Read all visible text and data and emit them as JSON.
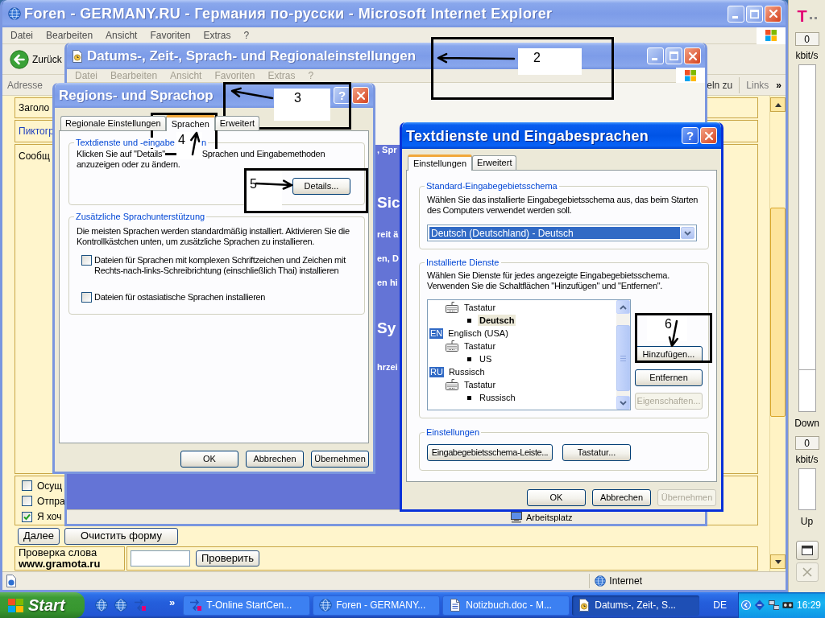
{
  "browser_window": {
    "title": "Foren - GERMANY.RU - Германия по-русски - Microsoft Internet Explorer",
    "active": false,
    "menu": {
      "disabled": false,
      "items": [
        "Datei",
        "Bearbeiten",
        "Ansicht",
        "Favoriten",
        "Extras",
        "?"
      ]
    },
    "back_button": "Zurück",
    "address_label": "Adresse",
    "go_button": "eln zu",
    "links_label": "Links",
    "links_more": "»",
    "page": {
      "form_rows": [
        {
          "kind": "label",
          "text": "Заголо"
        },
        {
          "kind": "link",
          "text": "Пиктогр"
        },
        {
          "kind": "label",
          "text": "Сообщ"
        }
      ],
      "options": [
        {
          "label": "Осущ",
          "checked": false
        },
        {
          "label": "Отпра",
          "checked": false
        },
        {
          "label": "Я хоч",
          "checked": true
        }
      ],
      "buttons": [
        "Далее",
        "Очистить форму"
      ],
      "spellcheck": {
        "label": "Проверка слова",
        "link": "www.gramota.ru",
        "button": "Проверить"
      }
    },
    "status_zone": "Internet"
  },
  "bandwidth_sidebar": {
    "logo": "T",
    "download": {
      "reading": "0",
      "unit": "kbit/s",
      "label": "Down"
    },
    "upload": {
      "reading": "0",
      "unit": "kbit/s",
      "label": "Up"
    }
  },
  "control_panel_window": {
    "title": "Datums-, Zeit-, Sprach- und Regionaleinstellungen",
    "active": false,
    "menu": {
      "disabled": true,
      "items": [
        "Datei",
        "Bearbeiten",
        "Ansicht",
        "Favoriten",
        "Extras",
        "?"
      ]
    },
    "content_fragments": [
      {
        "kind": "text",
        "text": ", Spr"
      },
      {
        "kind": "heading",
        "text": "Sic"
      },
      {
        "kind": "text",
        "text": "reit ä"
      },
      {
        "kind": "text",
        "text": "en, D"
      },
      {
        "kind": "text",
        "text": "en hi"
      },
      {
        "kind": "heading",
        "text": "Sy"
      },
      {
        "kind": "text",
        "text": "hrzei"
      }
    ],
    "status": "Arbeitsplatz"
  },
  "regional_dialog": {
    "title": "Regions- und Sprachop",
    "active": false,
    "help_button": "?",
    "tabs": [
      {
        "label": "Regionale Einstellungen",
        "selected": false
      },
      {
        "label": "Sprachen",
        "selected": true
      },
      {
        "label": "Erweitert",
        "selected": false
      }
    ],
    "text_services": {
      "title_parts": [
        "Textdienste und -eingabe",
        "n"
      ],
      "text_parts": [
        "Klicken Sie auf \"Details\"",
        "Sprachen und Eingabemethoden",
        "anzuzeigen oder zu ändern."
      ],
      "button": "Details..."
    },
    "supplemental": {
      "title": "Zusätzliche Sprachunterstützung",
      "text": "Die meisten Sprachen werden standardmäßig installiert. Aktivieren Sie die Kontrollkästchen unten, um zusätzliche Sprachen zu installieren.",
      "options": [
        {
          "label": "Dateien für Sprachen mit komplexen Schriftzeichen und Zeichen mit Rechts-nach-links-Schreibrichtung (einschließlich Thai) installieren",
          "checked": false
        },
        {
          "label": "Dateien für ostasiatische Sprachen installieren",
          "checked": false
        }
      ]
    },
    "buttons": [
      {
        "label": "OK",
        "disabled": false
      },
      {
        "label": "Abbrechen",
        "disabled": false
      },
      {
        "label": "Übernehmen",
        "disabled": false
      }
    ]
  },
  "text_services_dialog": {
    "title": "Textdienste und Eingabesprachen",
    "active": true,
    "help_button": "?",
    "tabs": [
      {
        "label": "Einstellungen",
        "selected": true
      },
      {
        "label": "Erweitert",
        "selected": false
      }
    ],
    "default_language": {
      "title": "Standard-Eingabegebietsschema",
      "text": "Wählen Sie das installierte Eingabegebietsschema aus, das beim Starten des Computers verwendet werden soll.",
      "value": "Deutsch (Deutschland) - Deutsch",
      "highlighted": true
    },
    "installed_services": {
      "title": "Installierte Dienste",
      "text": "Wählen Sie Dienste für jedes angezeigte Eingabegebietsschema. Verwenden Sie die Schaltflächen \"Hinzufügen\" und \"Entfernen\".",
      "tree": [
        {
          "children": [
            {
              "kind": "category",
              "label": "Tastatur",
              "selected": false,
              "children": [
                {
                  "kind": "layout",
                  "label": "Deutsch",
                  "selected": true,
                  "default": true
                }
              ]
            }
          ]
        },
        {
          "kind": "language",
          "badge": "EN",
          "label": "Englisch (USA)",
          "selected": false,
          "children": [
            {
              "kind": "category",
              "label": "Tastatur",
              "selected": false,
              "children": [
                {
                  "kind": "layout",
                  "label": "US",
                  "selected": false,
                  "default": false
                }
              ]
            }
          ]
        },
        {
          "kind": "language",
          "badge": "RU",
          "label": "Russisch",
          "selected": false,
          "children": [
            {
              "kind": "category",
              "label": "Tastatur",
              "selected": false,
              "children": [
                {
                  "kind": "layout",
                  "label": "Russisch",
                  "selected": false,
                  "default": false
                }
              ]
            }
          ]
        }
      ],
      "buttons": [
        {
          "label": "Hinzufügen...",
          "disabled": false
        },
        {
          "label": "Entfernen",
          "disabled": false
        },
        {
          "label": "Eigenschaften...",
          "disabled": true
        }
      ]
    },
    "preferences": {
      "title": "Einstellungen",
      "buttons": [
        "Eingabegebietsschema-Leiste...",
        "Tastatur..."
      ]
    },
    "buttons": [
      {
        "label": "OK",
        "disabled": false
      },
      {
        "label": "Abbrechen",
        "disabled": false
      },
      {
        "label": "Übernehmen",
        "disabled": true
      }
    ]
  },
  "annotations": [
    {
      "number": "2"
    },
    {
      "number": "3"
    },
    {
      "number": "4"
    },
    {
      "number": "5"
    },
    {
      "number": "6"
    }
  ],
  "taskbar": {
    "start": "Start",
    "more": "»",
    "tasks": [
      {
        "kind": "network",
        "label": "T-Online StartCen...",
        "selected": false
      },
      {
        "kind": "browser",
        "label": "Foren - GERMANY...",
        "selected": false
      },
      {
        "kind": "document",
        "label": "Notizbuch.doc - M...",
        "selected": false
      },
      {
        "kind": "settings",
        "label": "Datums-, Zeit-, S...",
        "selected": true
      }
    ],
    "language": "DE",
    "clock": "16:29"
  }
}
